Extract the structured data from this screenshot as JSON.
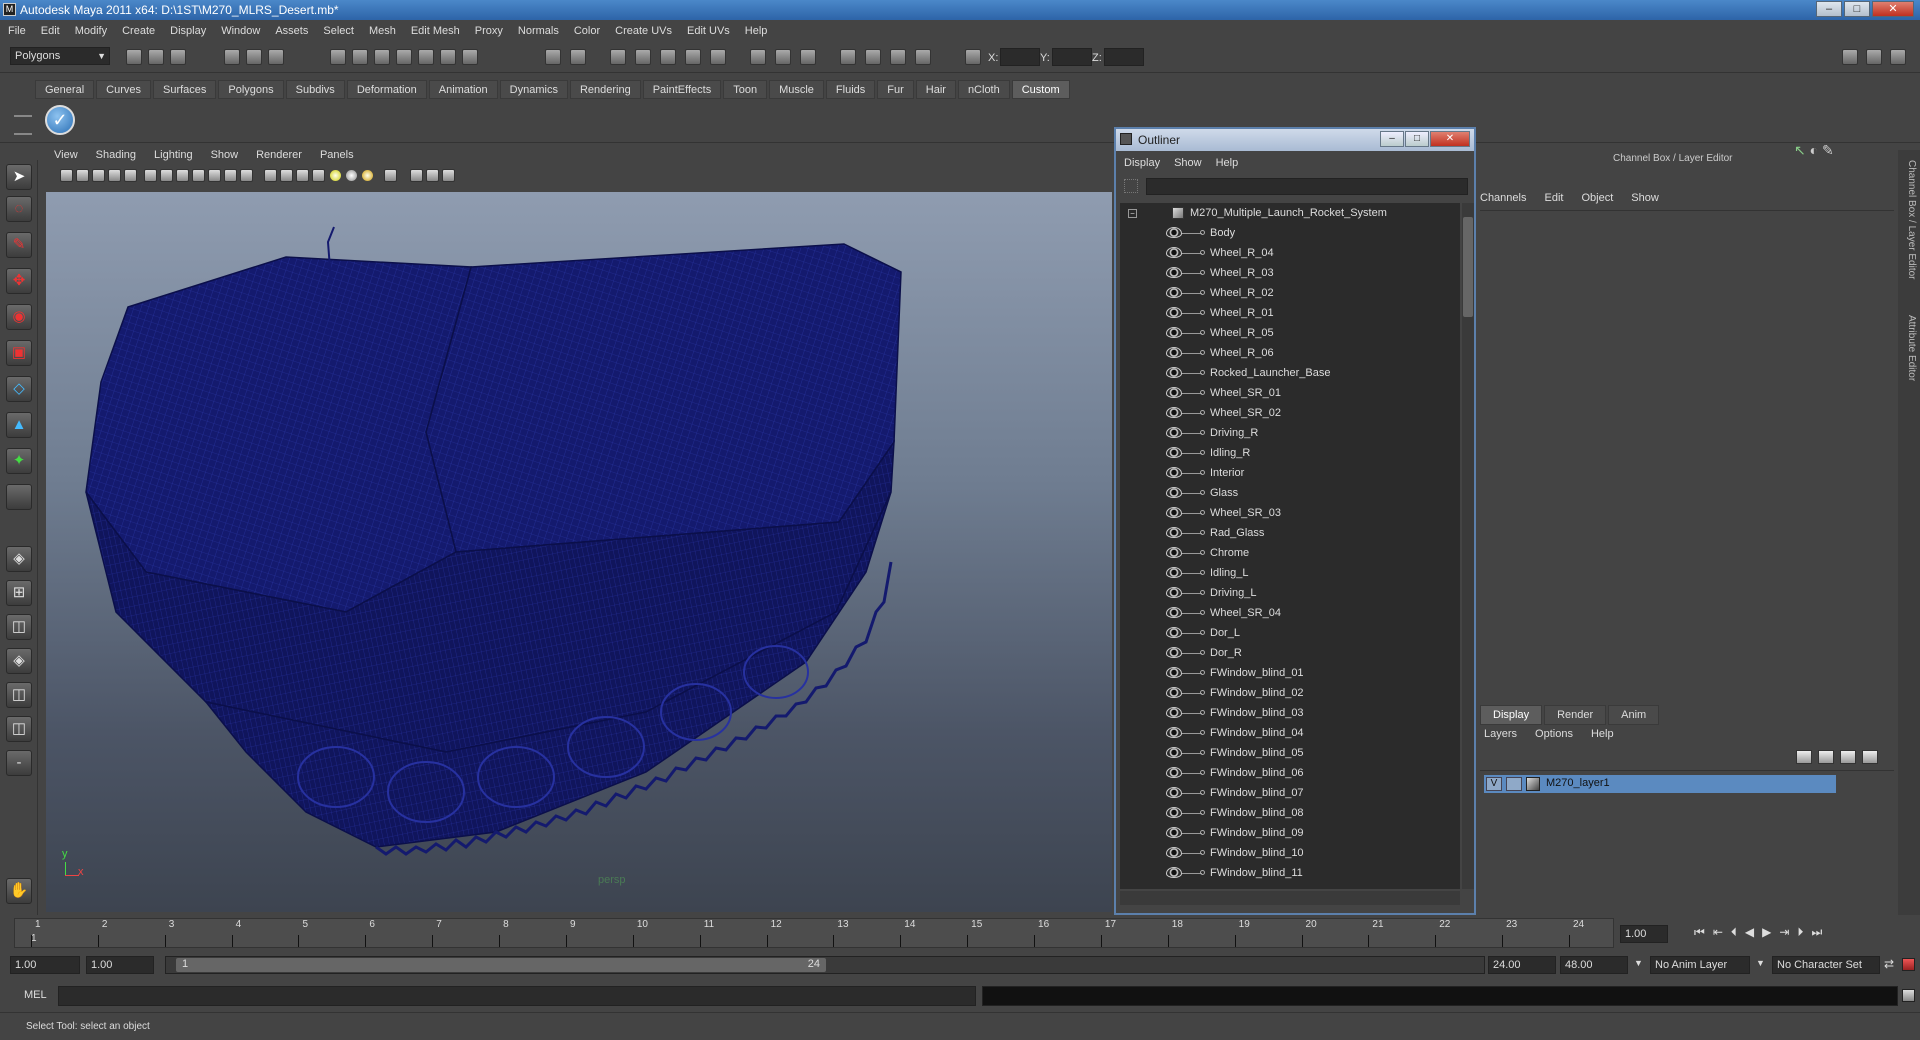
{
  "window": {
    "app_icon": "maya-icon",
    "title": "Autodesk Maya 2011 x64: D:\\1ST\\M270_MLRS_Desert.mb*"
  },
  "menubar": [
    "File",
    "Edit",
    "Modify",
    "Create",
    "Display",
    "Window",
    "Assets",
    "Select",
    "Mesh",
    "Edit Mesh",
    "Proxy",
    "Normals",
    "Color",
    "Create UVs",
    "Edit UVs",
    "Help"
  ],
  "status_line": {
    "mode": "Polygons",
    "x_label": "X:",
    "y_label": "Y:",
    "z_label": "Z:"
  },
  "shelf_tabs": [
    "General",
    "Curves",
    "Surfaces",
    "Polygons",
    "Subdivs",
    "Deformation",
    "Animation",
    "Dynamics",
    "Rendering",
    "PaintEffects",
    "Toon",
    "Muscle",
    "Fluids",
    "Fur",
    "Hair",
    "nCloth",
    "Custom"
  ],
  "shelf_active": "Custom",
  "viewport": {
    "menu": [
      "View",
      "Shading",
      "Lighting",
      "Show",
      "Renderer",
      "Panels"
    ],
    "camera_label": "persp",
    "axis_y": "y",
    "axis_x": "x"
  },
  "outliner": {
    "title": "Outliner",
    "menu": [
      "Display",
      "Show",
      "Help"
    ],
    "root": "M270_Multiple_Launch_Rocket_System",
    "items": [
      "Body",
      "Wheel_R_04",
      "Wheel_R_03",
      "Wheel_R_02",
      "Wheel_R_01",
      "Wheel_R_05",
      "Wheel_R_06",
      "Rocked_Launcher_Base",
      "Wheel_SR_01",
      "Wheel_SR_02",
      "Driving_R",
      "Idling_R",
      "Interior",
      "Glass",
      "Wheel_SR_03",
      "Rad_Glass",
      "Chrome",
      "Idling_L",
      "Driving_L",
      "Wheel_SR_04",
      "Dor_L",
      "Dor_R",
      "FWindow_blind_01",
      "FWindow_blind_02",
      "FWindow_blind_03",
      "FWindow_blind_04",
      "FWindow_blind_05",
      "FWindow_blind_06",
      "FWindow_blind_07",
      "FWindow_blind_08",
      "FWindow_blind_09",
      "FWindow_blind_10",
      "FWindow_blind_11"
    ]
  },
  "channel_box": {
    "title": "Channel Box / Layer Editor",
    "menu": [
      "Channels",
      "Edit",
      "Object",
      "Show"
    ],
    "layer_tabs": [
      "Display",
      "Render",
      "Anim"
    ],
    "layer_tab_active": "Display",
    "layer_menu": [
      "Layers",
      "Options",
      "Help"
    ],
    "layer": {
      "visible": "V",
      "name": "M270_layer1"
    }
  },
  "side_tabs": [
    "Channel Box / Layer Editor",
    "Attribute Editor"
  ],
  "timeline": {
    "ticks": [
      "1",
      "2",
      "3",
      "4",
      "5",
      "6",
      "7",
      "8",
      "9",
      "10",
      "11",
      "12",
      "13",
      "14",
      "15",
      "16",
      "17",
      "18",
      "19",
      "20",
      "21",
      "22",
      "23",
      "24"
    ],
    "current_frame_marker": "1",
    "current_frame": "1.00"
  },
  "range": {
    "start": "1.00",
    "playback_start": "1.00",
    "slider_start": "1",
    "slider_end": "24",
    "playback_end": "24.00",
    "end": "48.00",
    "anim_layer": "No Anim Layer",
    "char_set": "No Character Set"
  },
  "cmd": {
    "label": "MEL"
  },
  "help_line": "Select Tool: select an object",
  "colors": {
    "title_bar": "#3a75bb",
    "mesh": "#141a6e",
    "layer_highlight": "#5b8ac0",
    "active_tab": "#5d5d5d"
  }
}
